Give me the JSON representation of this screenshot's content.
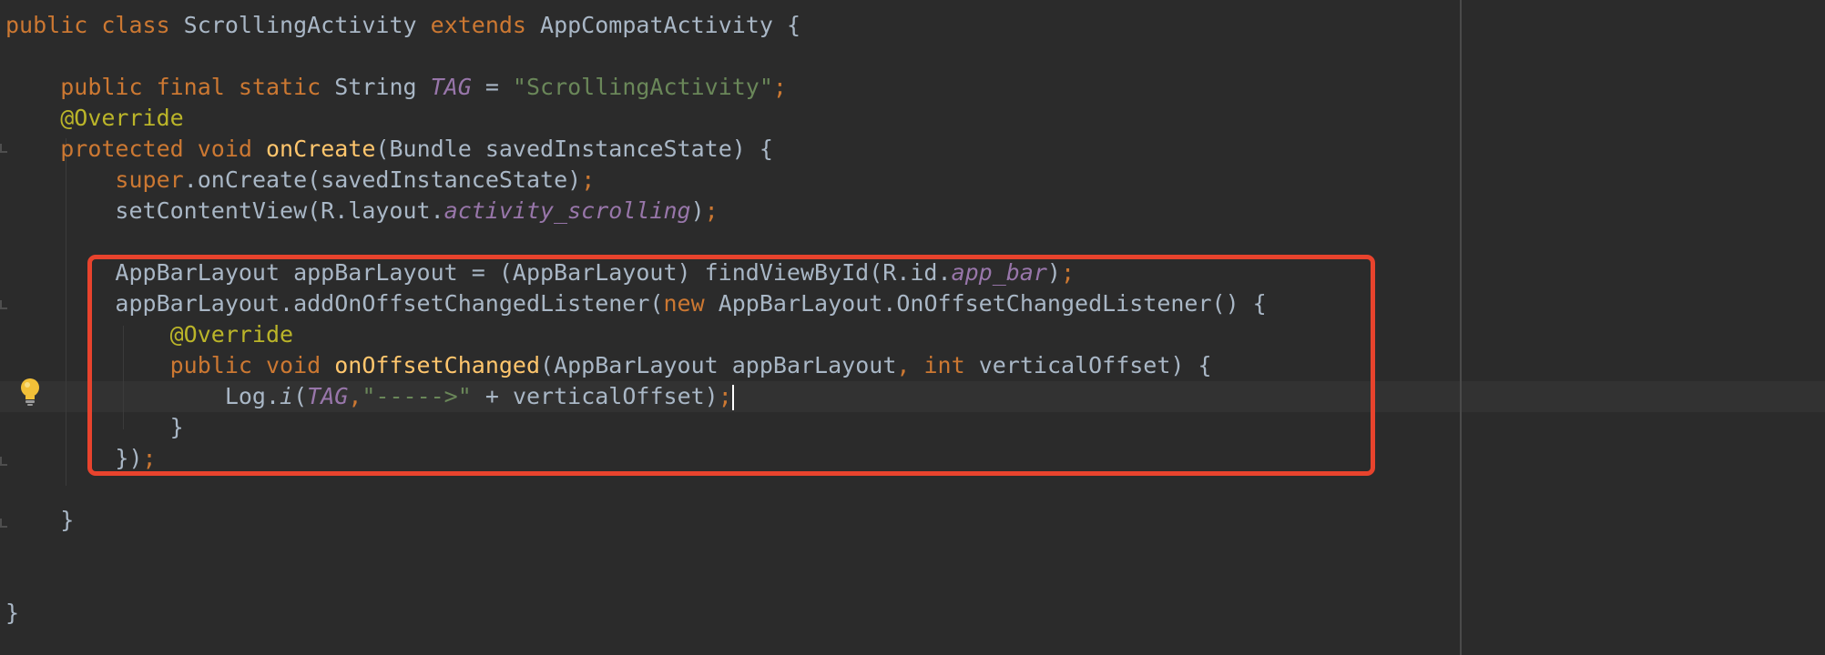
{
  "editor": {
    "caret_line": 13,
    "code_lines": [
      {
        "line": 1,
        "tokens": [
          {
            "c": "kw",
            "t": "public class "
          },
          {
            "c": "plain",
            "t": "ScrollingActivity "
          },
          {
            "c": "kw",
            "t": "extends "
          },
          {
            "c": "plain",
            "t": "AppCompatActivity {"
          }
        ]
      },
      {
        "line": 2,
        "tokens": []
      },
      {
        "line": 3,
        "tokens": [
          {
            "c": "plain",
            "t": "    "
          },
          {
            "c": "kw",
            "t": "public final static "
          },
          {
            "c": "plain",
            "t": "String "
          },
          {
            "c": "fld",
            "t": "TAG"
          },
          {
            "c": "plain",
            "t": " = "
          },
          {
            "c": "str",
            "t": "\"ScrollingActivity\""
          },
          {
            "c": "kw",
            "t": ";"
          }
        ]
      },
      {
        "line": 4,
        "tokens": [
          {
            "c": "plain",
            "t": "    "
          },
          {
            "c": "ann",
            "t": "@Override"
          }
        ]
      },
      {
        "line": 5,
        "tokens": [
          {
            "c": "plain",
            "t": "    "
          },
          {
            "c": "kw",
            "t": "protected void "
          },
          {
            "c": "fn",
            "t": "onCreate"
          },
          {
            "c": "plain",
            "t": "(Bundle savedInstanceState) {"
          }
        ]
      },
      {
        "line": 6,
        "tokens": [
          {
            "c": "plain",
            "t": "        "
          },
          {
            "c": "kw",
            "t": "super"
          },
          {
            "c": "plain",
            "t": ".onCreate(savedInstanceState)"
          },
          {
            "c": "kw",
            "t": ";"
          }
        ]
      },
      {
        "line": 7,
        "tokens": [
          {
            "c": "plain",
            "t": "        setContentView(R.layout."
          },
          {
            "c": "fld",
            "t": "activity_scrolling"
          },
          {
            "c": "plain",
            "t": ")"
          },
          {
            "c": "kw",
            "t": ";"
          }
        ]
      },
      {
        "line": 8,
        "tokens": []
      },
      {
        "line": 9,
        "tokens": [
          {
            "c": "plain",
            "t": "        AppBarLayout appBarLayout = (AppBarLayout) findViewById(R.id."
          },
          {
            "c": "fld",
            "t": "app_bar"
          },
          {
            "c": "plain",
            "t": ")"
          },
          {
            "c": "kw",
            "t": ";"
          }
        ]
      },
      {
        "line": 10,
        "tokens": [
          {
            "c": "plain",
            "t": "        appBarLayout.addOnOffsetChangedListener("
          },
          {
            "c": "kw",
            "t": "new "
          },
          {
            "c": "plain",
            "t": "AppBarLayout.OnOffsetChangedListener() {"
          }
        ]
      },
      {
        "line": 11,
        "tokens": [
          {
            "c": "plain",
            "t": "            "
          },
          {
            "c": "ann",
            "t": "@Override"
          }
        ]
      },
      {
        "line": 12,
        "tokens": [
          {
            "c": "plain",
            "t": "            "
          },
          {
            "c": "kw",
            "t": "public void "
          },
          {
            "c": "fn",
            "t": "onOffsetChanged"
          },
          {
            "c": "plain",
            "t": "(AppBarLayout appBarLayout"
          },
          {
            "c": "kw",
            "t": ", int "
          },
          {
            "c": "plain",
            "t": "verticalOffset) {"
          }
        ]
      },
      {
        "line": 13,
        "tokens": [
          {
            "c": "plain",
            "t": "                Log."
          },
          {
            "c": "ital",
            "t": "i"
          },
          {
            "c": "plain",
            "t": "("
          },
          {
            "c": "fld",
            "t": "TAG"
          },
          {
            "c": "kw",
            "t": ","
          },
          {
            "c": "str",
            "t": "\"----->\""
          },
          {
            "c": "plain",
            "t": " + verticalOffset)"
          },
          {
            "c": "kw",
            "t": ";"
          }
        ]
      },
      {
        "line": 14,
        "tokens": [
          {
            "c": "plain",
            "t": "            }"
          }
        ]
      },
      {
        "line": 15,
        "tokens": [
          {
            "c": "plain",
            "t": "        })"
          },
          {
            "c": "kw",
            "t": ";"
          }
        ]
      },
      {
        "line": 16,
        "tokens": []
      },
      {
        "line": 17,
        "tokens": [
          {
            "c": "plain",
            "t": "    }"
          }
        ]
      },
      {
        "line": 18,
        "tokens": []
      },
      {
        "line": 19,
        "tokens": []
      },
      {
        "line": 20,
        "tokens": [
          {
            "c": "plain",
            "t": "}"
          }
        ]
      }
    ]
  },
  "icons": {
    "intention_bulb": "lightbulb-icon"
  },
  "colors": {
    "background": "#2b2b2b",
    "keyword": "#cc7832",
    "string": "#6a8759",
    "annotation": "#bbb529",
    "field": "#9876aa",
    "method": "#ffc66d",
    "text": "#a9b7c6",
    "highlight_box": "#e8432d"
  }
}
